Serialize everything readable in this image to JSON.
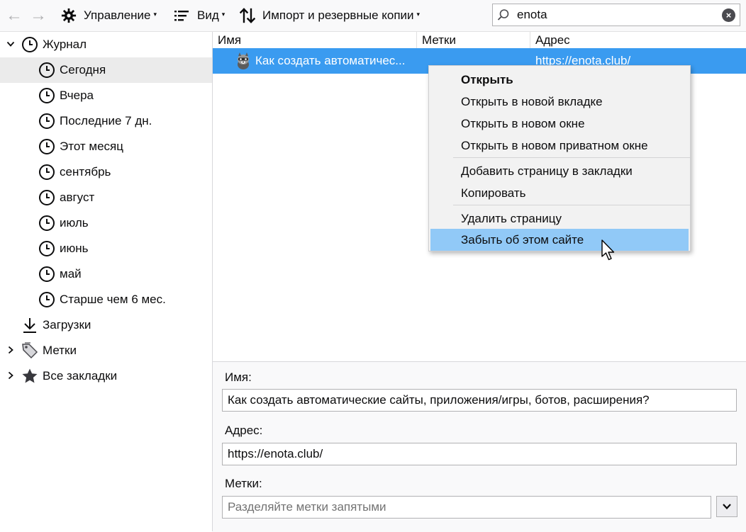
{
  "toolbar": {
    "back_label": "←",
    "forward_label": "→",
    "organize_label": "Управление",
    "views_label": "Вид",
    "import_label": "Импорт и резервные копии",
    "caret": "▾"
  },
  "search": {
    "value": "enota",
    "placeholder": "",
    "clear_icon": "×"
  },
  "sidebar": {
    "items": [
      {
        "label": "Журнал",
        "icon": "clock-icon",
        "twisty": "expanded"
      },
      {
        "label": "Сегодня",
        "icon": "clock-icon",
        "selected": true
      },
      {
        "label": "Вчера",
        "icon": "clock-icon"
      },
      {
        "label": "Последние 7 дн.",
        "icon": "clock-icon"
      },
      {
        "label": "Этот месяц",
        "icon": "clock-icon"
      },
      {
        "label": "сентябрь",
        "icon": "clock-icon"
      },
      {
        "label": "август",
        "icon": "clock-icon"
      },
      {
        "label": "июль",
        "icon": "clock-icon"
      },
      {
        "label": "июнь",
        "icon": "clock-icon"
      },
      {
        "label": "май",
        "icon": "clock-icon"
      },
      {
        "label": "Старше чем 6 мес.",
        "icon": "clock-icon"
      },
      {
        "label": "Загрузки",
        "icon": "download-icon"
      },
      {
        "label": "Метки",
        "icon": "tag-icon",
        "twisty": "collapsed"
      },
      {
        "label": "Все закладки",
        "icon": "star-icon",
        "twisty": "collapsed"
      }
    ]
  },
  "table": {
    "columns": [
      "Имя",
      "Метки",
      "Адрес"
    ],
    "rows": [
      {
        "name": "Как создать автоматичес...",
        "tags": "",
        "url": "https://enota.club/",
        "icon": "raccoon-favicon"
      }
    ]
  },
  "context_menu": {
    "items": [
      {
        "label": "Открыть",
        "bold": true
      },
      {
        "label": "Открыть в новой вкладке"
      },
      {
        "label": "Открыть в новом окне"
      },
      {
        "label": "Открыть в новом приватном окне"
      },
      {
        "label": "Добавить страницу в закладки"
      },
      {
        "label": "Копировать"
      },
      {
        "label": "Удалить страницу"
      },
      {
        "label": "Забыть об этом сайте",
        "hovered": true
      }
    ]
  },
  "details": {
    "name_label": "Имя:",
    "name_value": "Как создать автоматические сайты, приложения/игры, ботов, расширения?",
    "address_label": "Адрес:",
    "address_value": "https://enota.club/",
    "tags_label": "Метки:",
    "tags_placeholder": "Разделяйте метки запятыми"
  },
  "colors": {
    "selection": "#3a9bf0",
    "menu_hover": "#91c9f7",
    "toolbar_bg": "#f9f9fa",
    "tree_selected": "#ebebeb"
  }
}
